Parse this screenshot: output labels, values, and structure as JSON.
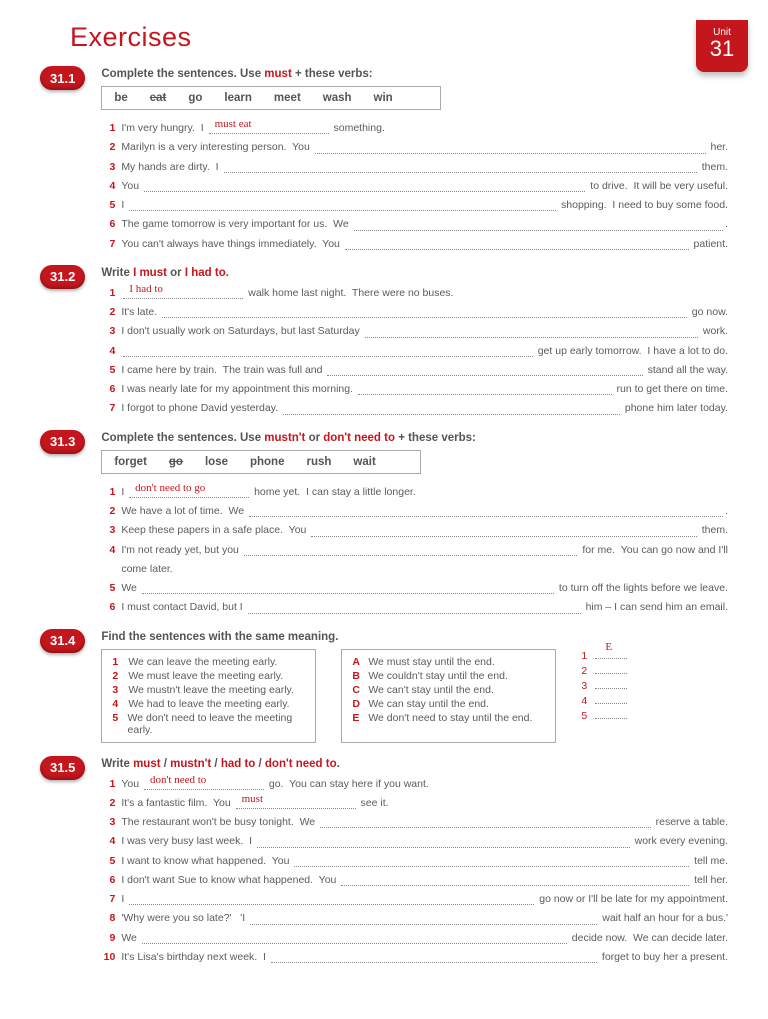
{
  "unit": {
    "label": "Unit",
    "number": "31"
  },
  "page_title": "Exercises",
  "ex1": {
    "id": "31.1",
    "instr_a": "Complete the sentences.  Use ",
    "instr_kw": "must",
    "instr_b": " + these verbs:",
    "verbs": [
      "be",
      "eat",
      "go",
      "learn",
      "meet",
      "wash",
      "win"
    ],
    "struck_index": 1,
    "lines": [
      {
        "n": "1",
        "a": "I'm very hungry.  I ",
        "ans": "must eat",
        "b": " something."
      },
      {
        "n": "2",
        "a": "Marilyn is a very interesting person.  You ",
        "b": " her."
      },
      {
        "n": "3",
        "a": "My hands are dirty.  I ",
        "b": " them."
      },
      {
        "n": "4",
        "a": "You ",
        "b": " to drive.  It will be very useful."
      },
      {
        "n": "5",
        "a": "I ",
        "b": " shopping.  I need to buy some food."
      },
      {
        "n": "6",
        "a": "The game tomorrow is very important for us.  We ",
        "b": "."
      },
      {
        "n": "7",
        "a": "You can't always have things immediately.  You ",
        "b": " patient."
      }
    ]
  },
  "ex2": {
    "id": "31.2",
    "instr_a": "Write ",
    "kw1": "I must",
    "instr_b": " or ",
    "kw2": "I had to",
    "instr_c": ".",
    "lines": [
      {
        "n": "1",
        "a": "",
        "ans": "I had to",
        "b": " walk home last night.  There were no buses."
      },
      {
        "n": "2",
        "a": "It's late. ",
        "b": " go now."
      },
      {
        "n": "3",
        "a": "I don't usually work on Saturdays, but last Saturday ",
        "b": " work."
      },
      {
        "n": "4",
        "a": "",
        "b": " get up early tomorrow.  I have a lot to do."
      },
      {
        "n": "5",
        "a": "I came here by train.  The train was full and ",
        "b": " stand all the way."
      },
      {
        "n": "6",
        "a": "I was nearly late for my appointment this morning. ",
        "b": " run to get there on time."
      },
      {
        "n": "7",
        "a": "I forgot to phone David yesterday. ",
        "b": " phone him later today."
      }
    ]
  },
  "ex3": {
    "id": "31.3",
    "instr_a": "Complete the sentences.  Use ",
    "kw1": "mustn't",
    "instr_b": " or ",
    "kw2": "don't need to",
    "instr_c": " + these verbs:",
    "verbs": [
      "forget",
      "go",
      "lose",
      "phone",
      "rush",
      "wait"
    ],
    "struck_index": 1,
    "lines": [
      {
        "n": "1",
        "a": "I ",
        "ans": "don't need to go",
        "b": " home yet.  I can stay a little longer."
      },
      {
        "n": "2",
        "a": "We have a lot of time.  We ",
        "b": "."
      },
      {
        "n": "3",
        "a": "Keep these papers in a safe place.  You ",
        "b": " them."
      },
      {
        "n": "4",
        "a": "I'm not ready yet, but you ",
        "b": " for me.  You can go now and I'll",
        "c": "come later."
      },
      {
        "n": "5",
        "a": "We ",
        "b": " to turn off the lights before we leave."
      },
      {
        "n": "6",
        "a": "I must contact David, but I ",
        "b": " him – I can send him an email."
      }
    ]
  },
  "ex4": {
    "id": "31.4",
    "instr": "Find the sentences with the same meaning.",
    "left": [
      {
        "n": "1",
        "t": "We can leave the meeting early."
      },
      {
        "n": "2",
        "t": "We must leave the meeting early."
      },
      {
        "n": "3",
        "t": "We mustn't leave the meeting early."
      },
      {
        "n": "4",
        "t": "We had to leave the meeting early."
      },
      {
        "n": "5",
        "t": "We don't need to leave the meeting early."
      }
    ],
    "right": [
      {
        "n": "A",
        "t": "We must stay until the end."
      },
      {
        "n": "B",
        "t": "We couldn't stay until the end."
      },
      {
        "n": "C",
        "t": "We can't stay until the end."
      },
      {
        "n": "D",
        "t": "We can stay until the end."
      },
      {
        "n": "E",
        "t": "We don't need to stay until the end."
      }
    ],
    "answers": [
      {
        "n": "1",
        "ans": "E"
      },
      {
        "n": "2",
        "ans": ""
      },
      {
        "n": "3",
        "ans": ""
      },
      {
        "n": "4",
        "ans": ""
      },
      {
        "n": "5",
        "ans": ""
      }
    ]
  },
  "ex5": {
    "id": "31.5",
    "instr_a": "Write ",
    "k1": "must",
    "s1": " / ",
    "k2": "mustn't",
    "s2": " / ",
    "k3": "had to",
    "s3": " / ",
    "k4": "don't need to",
    "instr_b": ".",
    "lines": [
      {
        "n": "1",
        "a": "You ",
        "ans": "don't need to",
        "b": " go.  You can stay here if you want."
      },
      {
        "n": "2",
        "a": "It's a fantastic film.  You ",
        "ans": "must",
        "b": " see it."
      },
      {
        "n": "3",
        "a": "The restaurant won't be busy tonight.  We ",
        "b": " reserve a table."
      },
      {
        "n": "4",
        "a": "I was very busy last week.  I ",
        "b": " work every evening."
      },
      {
        "n": "5",
        "a": "I want to know what happened.  You ",
        "b": " tell me."
      },
      {
        "n": "6",
        "a": "I don't want Sue to know what happened.  You ",
        "b": " tell her."
      },
      {
        "n": "7",
        "a": "I ",
        "b": " go now or I'll be late for my appointment."
      },
      {
        "n": "8",
        "a": "'Why were you so late?'   'I ",
        "b": " wait half an hour for a bus.'"
      },
      {
        "n": "9",
        "a": "We ",
        "b": " decide now.  We can decide later."
      },
      {
        "n": "10",
        "a": "It's Lisa's birthday next week.  I ",
        "b": " forget to buy her a present."
      }
    ]
  }
}
